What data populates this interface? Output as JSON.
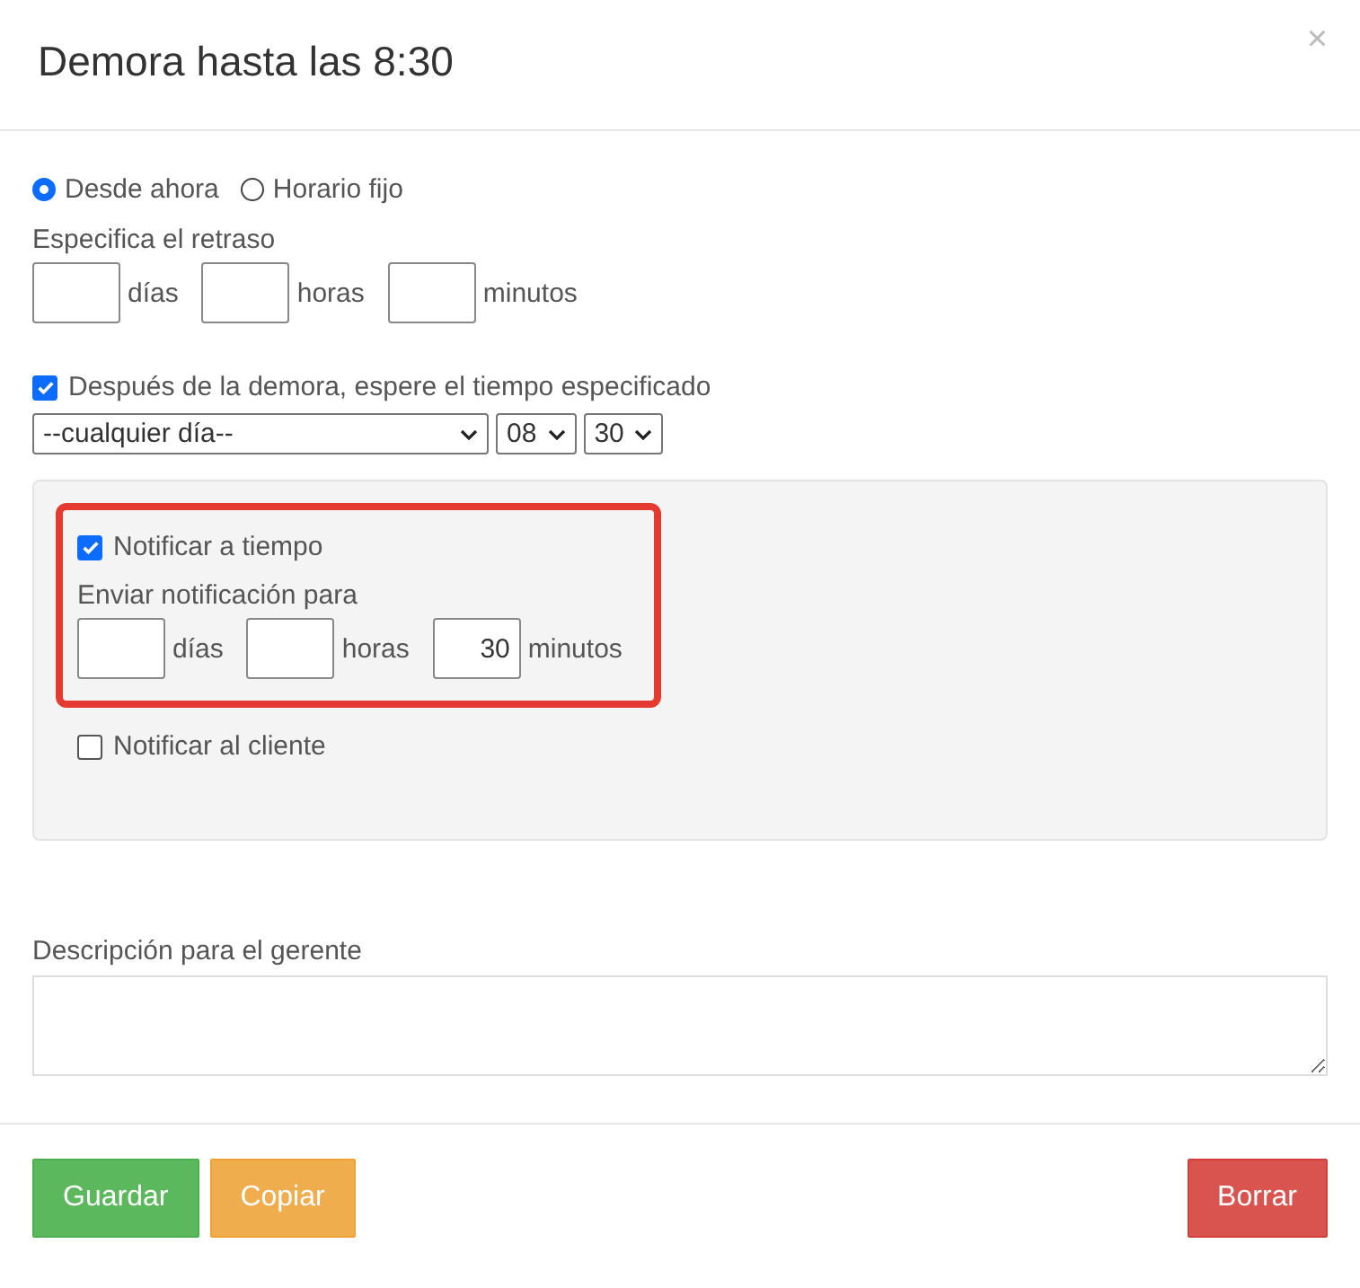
{
  "dialog": {
    "title": "Demora hasta las 8:30",
    "close": "×"
  },
  "mode": [
    {
      "label": "Desde ahora",
      "selected": true
    },
    {
      "label": "Horario fijo",
      "selected": false
    }
  ],
  "delay": {
    "label": "Especifica el retraso",
    "fields": [
      {
        "unit": "días"
      },
      {
        "unit": "horas"
      },
      {
        "unit": "minutos"
      }
    ]
  },
  "wait": {
    "label": "Después de la demora, espere el tiempo especificado",
    "checked": true,
    "day": "--cualquier día--",
    "hour": "08",
    "minute": "30"
  },
  "notify_on_time": {
    "label": "Notificar a tiempo",
    "checked": true,
    "sub_label": "Enviar notificación para",
    "fields": [
      {
        "unit": "días"
      },
      {
        "unit": "horas"
      },
      {
        "value": "30",
        "unit": "minutos"
      }
    ]
  },
  "notify_client": {
    "label": "Notificar al cliente",
    "checked": false
  },
  "description": {
    "label": "Descripción para el gerente"
  },
  "buttons": [
    {
      "label": "Guardar",
      "kind": "success"
    },
    {
      "label": "Copiar",
      "kind": "warning"
    },
    {
      "label": "Borrar",
      "kind": "danger"
    }
  ]
}
